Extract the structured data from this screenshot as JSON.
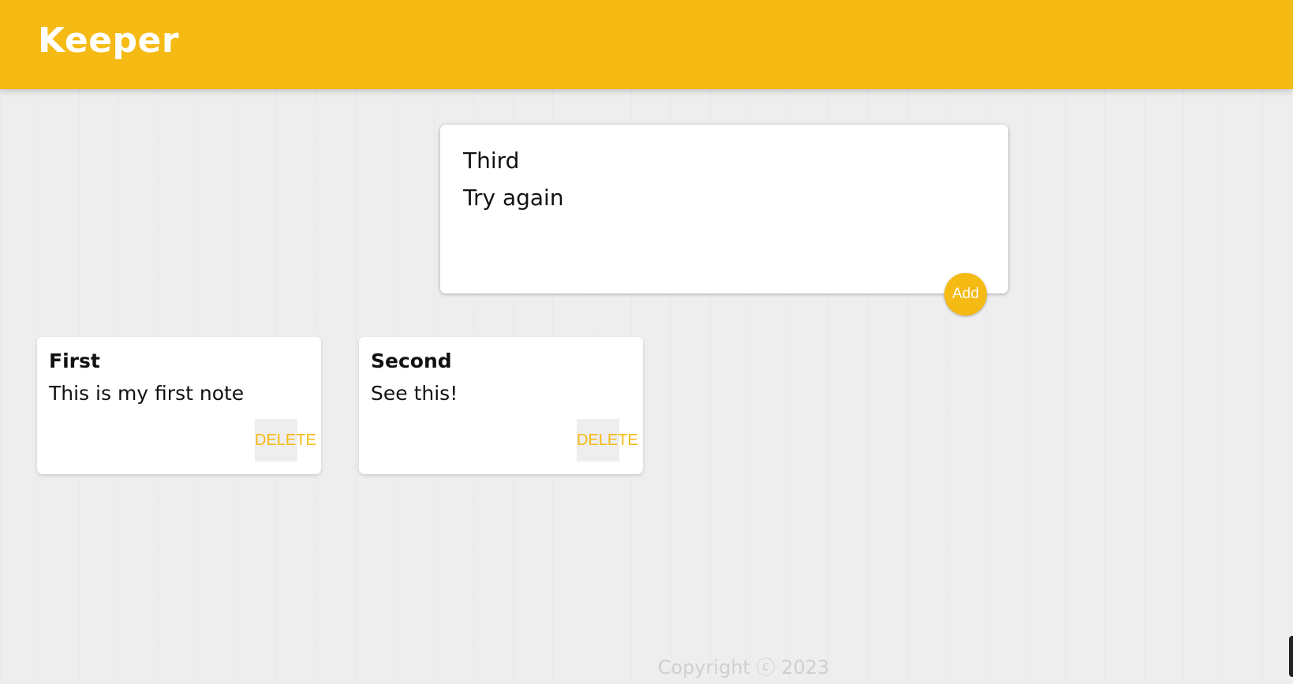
{
  "app": {
    "title": "Keeper",
    "accent_color": "#f5ba13"
  },
  "create_note": {
    "title_value": "Third",
    "content_value": "Try again",
    "add_label": "Add"
  },
  "notes": [
    {
      "title": "First",
      "content": "This is my first note",
      "delete_label": "DELETE"
    },
    {
      "title": "Second",
      "content": "See this!",
      "delete_label": "DELETE"
    }
  ],
  "footer": {
    "copyright": "Copyright ⓒ 2023"
  }
}
